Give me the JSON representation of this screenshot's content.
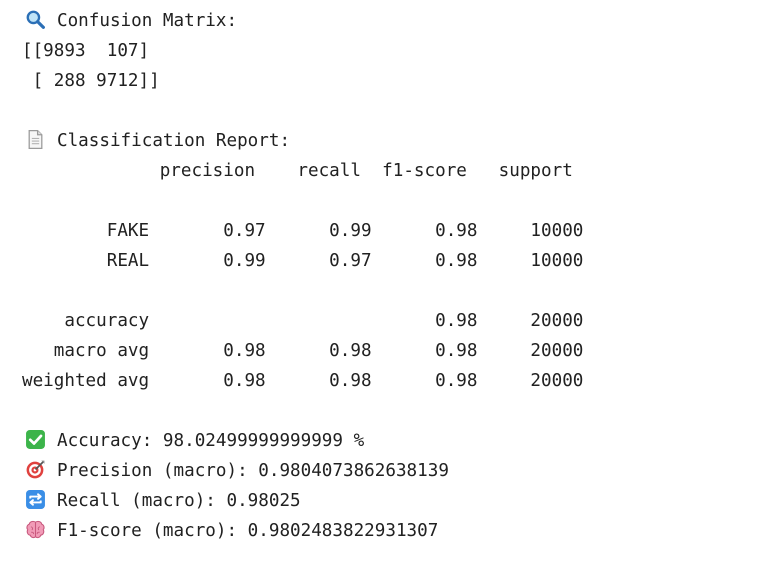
{
  "confusion": {
    "header": "Confusion Matrix:",
    "icon": "magnifying-glass-icon",
    "rows": [
      "[[9893  107]",
      " [ 288 9712]]"
    ]
  },
  "report": {
    "header": "Classification Report:",
    "icon": "page-document-icon",
    "col_header": "             precision    recall  f1-score   support",
    "rows": [
      "        FAKE       0.97      0.99      0.98     10000",
      "        REAL       0.99      0.97      0.98     10000",
      "    accuracy                           0.98     20000",
      "   macro avg       0.98      0.98      0.98     20000",
      "weighted avg       0.98      0.98      0.98     20000"
    ]
  },
  "metrics": [
    {
      "icon": "check-mark-button-icon",
      "text": "Accuracy: 98.02499999999999 %"
    },
    {
      "icon": "direct-hit-target-icon",
      "text": "Precision (macro): 0.9804073862638139"
    },
    {
      "icon": "repeat-arrows-icon",
      "text": "Recall (macro): 0.98025"
    },
    {
      "icon": "brain-icon",
      "text": "F1-score (macro): 0.9802483822931307"
    }
  ],
  "colors": {
    "text": "#212121",
    "check_green": "#3cb44a",
    "repeat_blue": "#3a8ee6",
    "target_red": "#e0413e",
    "brain_pink": "#f19bb7"
  }
}
